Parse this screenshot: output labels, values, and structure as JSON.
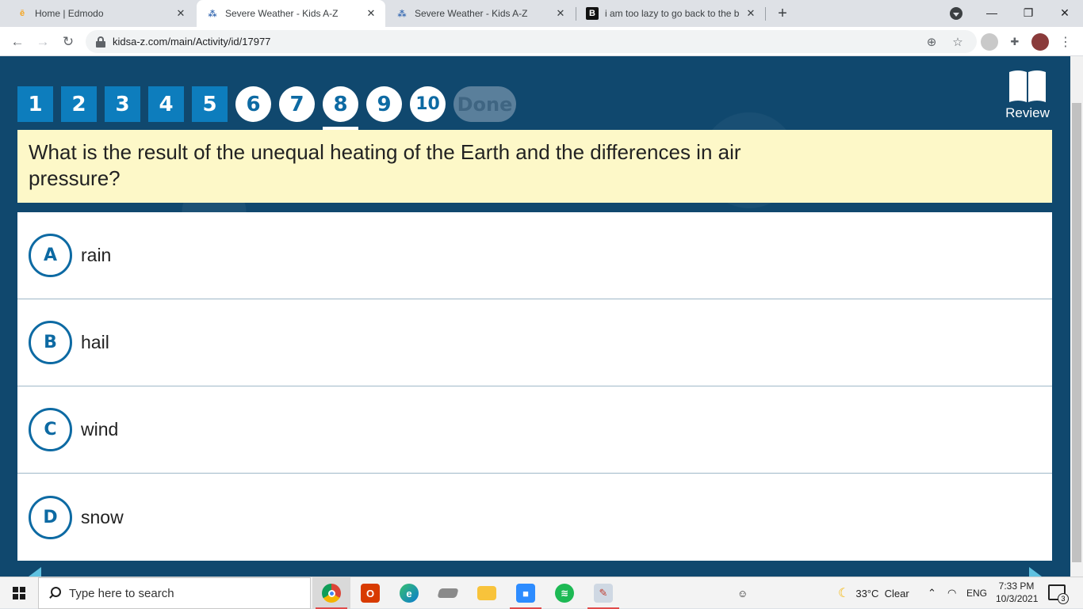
{
  "browser": {
    "tabs": [
      {
        "title": "Home | Edmodo",
        "favicon": "edmodo-icon"
      },
      {
        "title": "Severe Weather - Kids A-Z",
        "favicon": "kidsaz-icon"
      },
      {
        "title": "Severe Weather - Kids A-Z",
        "favicon": "kidsaz-icon"
      },
      {
        "title": "i am too lazy to go back to the b",
        "favicon": "b-icon"
      }
    ],
    "active_tab_index": 1,
    "url": "kidsa-z.com/main/Activity/id/17977"
  },
  "quiz": {
    "questions": [
      "1",
      "2",
      "3",
      "4",
      "5",
      "6",
      "7",
      "8",
      "9",
      "10"
    ],
    "answered_count": 5,
    "current_question": "8",
    "done_label": "Done",
    "review_label": "Review",
    "question_text": "What is the result of the unequal heating of the Earth and the differences in air pressure?",
    "answers": [
      {
        "letter": "A",
        "text": "rain"
      },
      {
        "letter": "B",
        "text": "hail"
      },
      {
        "letter": "C",
        "text": "wind"
      },
      {
        "letter": "D",
        "text": "snow"
      }
    ]
  },
  "taskbar": {
    "search_placeholder": "Type here to search",
    "weather": "33°C  Clear",
    "language": "ENG",
    "time": "7:33 PM",
    "date": "10/3/2021",
    "notification_count": "3"
  },
  "colors": {
    "page_bg": "#10486e",
    "answered_bg": "#0d7dbd",
    "accent_blue": "#0d6aa3",
    "question_bg": "#fdf8c8"
  }
}
